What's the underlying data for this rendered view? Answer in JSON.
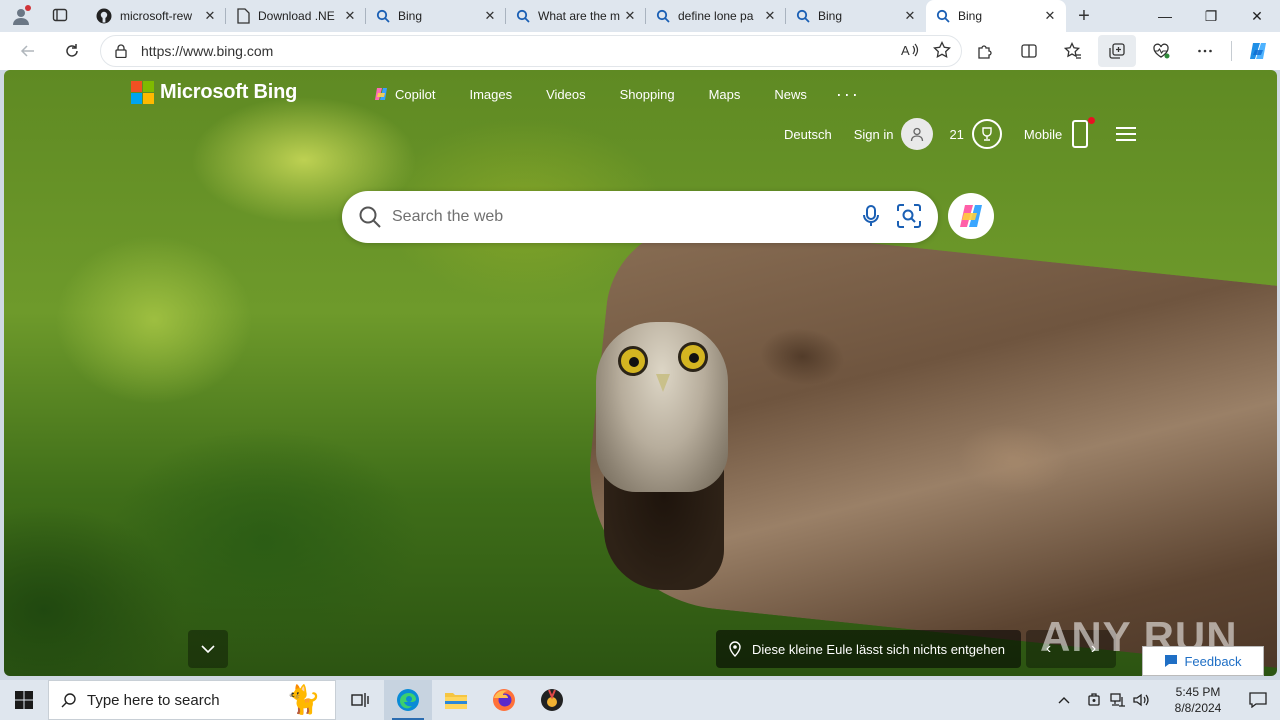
{
  "browser": {
    "tabs": [
      {
        "icon": "github-icon",
        "title": "microsoft-rew"
      },
      {
        "icon": "document-icon",
        "title": "Download .NE"
      },
      {
        "icon": "bing-search-icon",
        "title": "Bing"
      },
      {
        "icon": "bing-search-icon",
        "title": "What are the m"
      },
      {
        "icon": "bing-search-icon",
        "title": "define lone pa"
      },
      {
        "icon": "bing-search-icon",
        "title": "Bing"
      },
      {
        "icon": "bing-search-icon",
        "title": "Bing",
        "active": true
      }
    ],
    "new_tab": "+",
    "url": "https://www.bing.com",
    "window_controls": {
      "minimize": "—",
      "restore": "❐",
      "close": "✕"
    }
  },
  "bing": {
    "logo_text": "Microsoft Bing",
    "nav": [
      "Copilot",
      "Images",
      "Videos",
      "Shopping",
      "Maps",
      "News"
    ],
    "nav_more": "···",
    "language": "Deutsch",
    "sign_in": "Sign in",
    "rewards_count": "21",
    "mobile": "Mobile",
    "search_placeholder": "Search the web",
    "caption": "Diese kleine Eule lässt sich nichts entgehen",
    "watermark": "ANY RUN",
    "feedback": "Feedback"
  },
  "taskbar": {
    "search_placeholder": "Type here to search",
    "time": "5:45 PM",
    "date": "8/8/2024"
  },
  "colors": {
    "accent": "#2b6cb0",
    "brand_bing": "#0a6ec4",
    "feedback": "#1f6fc5"
  }
}
